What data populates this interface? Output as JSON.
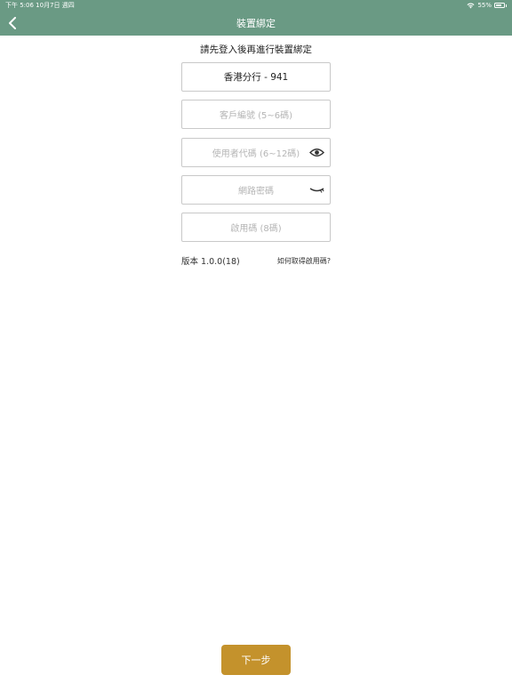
{
  "status_bar": {
    "time_date": "下午 5:06   10月7日 週四",
    "battery": "55%"
  },
  "nav": {
    "title": "裝置綁定",
    "back_icon": "chevron-left-icon"
  },
  "subtitle": "請先登入後再進行裝置綁定",
  "form": {
    "branch": "香港分行 - 941",
    "customer_id_placeholder": "客戶編號 (5~6碼)",
    "user_code_placeholder": "使用者代碼 (6~12碼)",
    "password_placeholder": "網路密碼",
    "activation_placeholder": "啟用碼 (8碼)"
  },
  "footer": {
    "version": "版本  1.0.0(18)",
    "help_link": "如何取得啟用碼?"
  },
  "next_button": "下一步",
  "colors": {
    "nav_bg": "#6a9a84",
    "primary_button": "#c4922c"
  }
}
